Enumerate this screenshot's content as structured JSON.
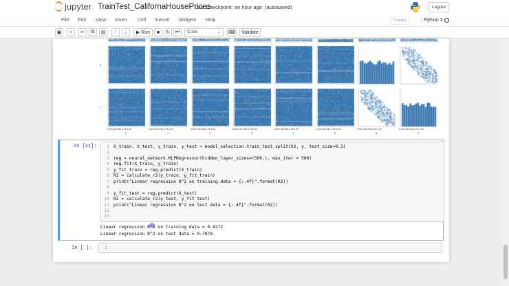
{
  "header": {
    "logo_text": "jupyter",
    "notebook_name": "TrainTest_CalifornaHousePrices",
    "checkpoint": "Last Checkpoint: an hour ago",
    "autosave": "(autosaved)",
    "logout": "Logout"
  },
  "menu": {
    "items": [
      "File",
      "Edit",
      "View",
      "Insert",
      "Cell",
      "Kernel",
      "Widgets",
      "Help"
    ],
    "trusted": "Trusted",
    "kernel": "Python 3"
  },
  "toolbar": {
    "run": "▶ Run",
    "cell_type": "Code",
    "validate": "Validate",
    "icons": [
      "save-icon",
      "add-cell-icon",
      "cut-icon",
      "copy-icon",
      "paste-icon",
      "move-up-icon",
      "move-down-icon",
      "run-icon",
      "stop-icon",
      "restart-icon",
      "fast-forward-icon",
      "keyboard-icon"
    ]
  },
  "plot": {
    "x_labels": [
      "0",
      "1",
      "2",
      "3",
      "4",
      "5",
      "6",
      "7"
    ],
    "y_labels": [
      "6",
      "7"
    ],
    "ticks": "0.00 0.25 0.50 0.75 1.00",
    "color": "#3a77b0"
  },
  "cell41": {
    "prompt": "In [41]:",
    "lines": [
      "X_train, X_test, y_train, y_test = model_selection.train_test_split(X2, y, test_size=0.3)",
      "",
      "reg = neural_network.MLPRegressor(hidden_layer_sizes=(500,), max_iter = 500)",
      "reg.fit(X_train, y_train)",
      "y_fit_train = reg.predict(X_train)",
      "R2 = calculate_r2(y_train, y_fit_train)",
      "print(\"Linear regression R^2 on training data = {:.4f}\".format(R2))",
      "",
      "y_fit_test = reg.predict(X_test)",
      "R2 = calculate_r2(y_test, y_fit_test)",
      "print(\"Linear regression R^2 on test data = {:.4f}\".format(R2))",
      "",
      ""
    ],
    "output": [
      "Linear regression R^2 on training data = 0.8272",
      "Linear regression R^2 on test data = 0.7978"
    ]
  },
  "cell_empty": {
    "prompt": "In [ ]:",
    "line": "1"
  }
}
